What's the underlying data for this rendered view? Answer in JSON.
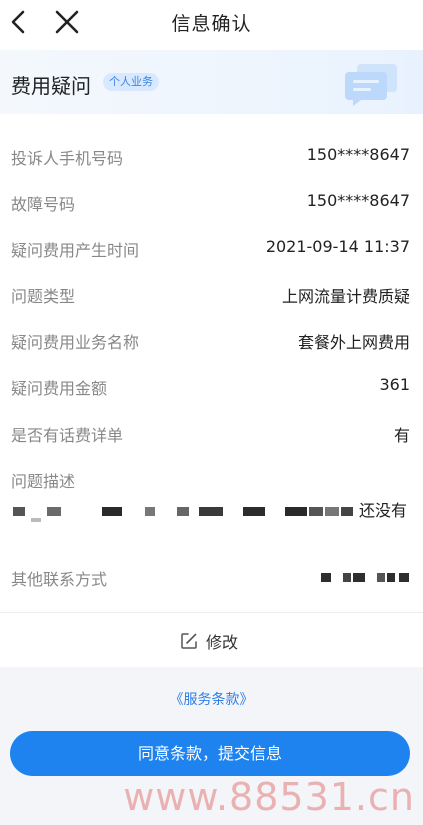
{
  "header": {
    "title": "信息确认"
  },
  "banner": {
    "title": "费用疑问",
    "badge": "个人业务",
    "accent": "#1f83ef"
  },
  "rows": [
    {
      "label": "投诉人手机号码",
      "value": "150****8647"
    },
    {
      "label": "故障号码",
      "value": "150****8647"
    },
    {
      "label": "疑问费用产生时间",
      "value": "2021-09-14 11:37"
    },
    {
      "label": "问题类型",
      "value": "上网流量计费质疑"
    },
    {
      "label": "疑问费用业务名称",
      "value": "套餐外上网费用"
    },
    {
      "label": "疑问费用金额",
      "value": "361"
    },
    {
      "label": "是否有话费详单",
      "value": "有"
    }
  ],
  "description": {
    "label": "问题描述",
    "visible_tail": "还没有"
  },
  "contact": {
    "label": "其他联系方式"
  },
  "actions": {
    "edit_label": "修改",
    "terms_label": "《服务条款》",
    "submit_label": "同意条款，提交信息"
  },
  "watermark": "www.88531.cn",
  "icons": {
    "back": "back-icon",
    "close": "close-icon",
    "chat": "chat-icon",
    "edit": "edit-icon"
  }
}
